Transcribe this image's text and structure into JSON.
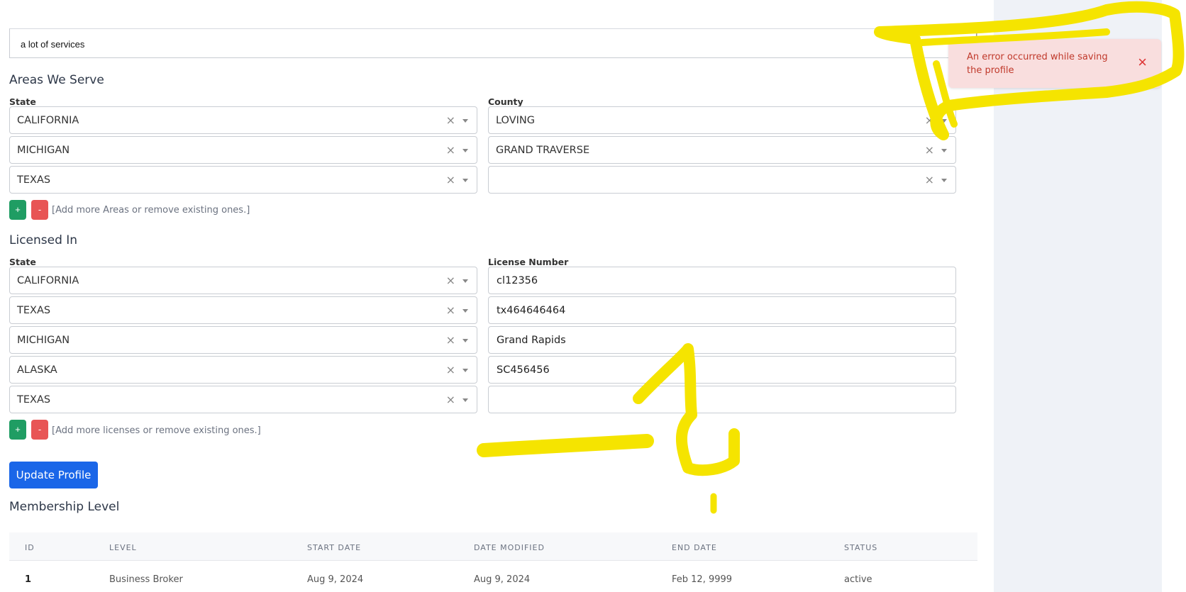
{
  "services_text": "a lot of services",
  "areas": {
    "title": "Areas We Serve",
    "state_label": "State",
    "county_label": "County",
    "rows": [
      {
        "state": "CALIFORNIA",
        "county": "LOVING"
      },
      {
        "state": "MICHIGAN",
        "county": "GRAND TRAVERSE"
      },
      {
        "state": "TEXAS",
        "county": ""
      }
    ],
    "add_label": "+",
    "remove_label": "-",
    "hint": "[Add more Areas or remove existing ones.]"
  },
  "licenses": {
    "title": "Licensed In",
    "state_label": "State",
    "number_label": "License Number",
    "rows": [
      {
        "state": "CALIFORNIA",
        "number": "cl12356"
      },
      {
        "state": "TEXAS",
        "number": "tx464646464"
      },
      {
        "state": "MICHIGAN",
        "number": "Grand Rapids"
      },
      {
        "state": "ALASKA",
        "number": "SC456456"
      },
      {
        "state": "TEXAS",
        "number": ""
      }
    ],
    "add_label": "+",
    "remove_label": "-",
    "hint": "[Add more licenses or remove existing ones.]"
  },
  "update_button": "Update Profile",
  "membership": {
    "title": "Membership Level",
    "columns": [
      "ID",
      "LEVEL",
      "START DATE",
      "DATE MODIFIED",
      "END DATE",
      "STATUS"
    ],
    "rows": [
      [
        "1",
        "Business Broker",
        "Aug 9, 2024",
        "Aug 9, 2024",
        "Feb 12, 9999",
        "active"
      ]
    ]
  },
  "toast": {
    "message": "An error occurred while saving the profile",
    "close_glyph": "×"
  },
  "glyphs": {
    "clear": "×"
  },
  "colors": {
    "primary": "#1a66e8",
    "add": "#1f9d63",
    "remove": "#e85555",
    "toast_bg": "#f9dede",
    "toast_text": "#c0392b",
    "annotation": "#f5e400"
  }
}
